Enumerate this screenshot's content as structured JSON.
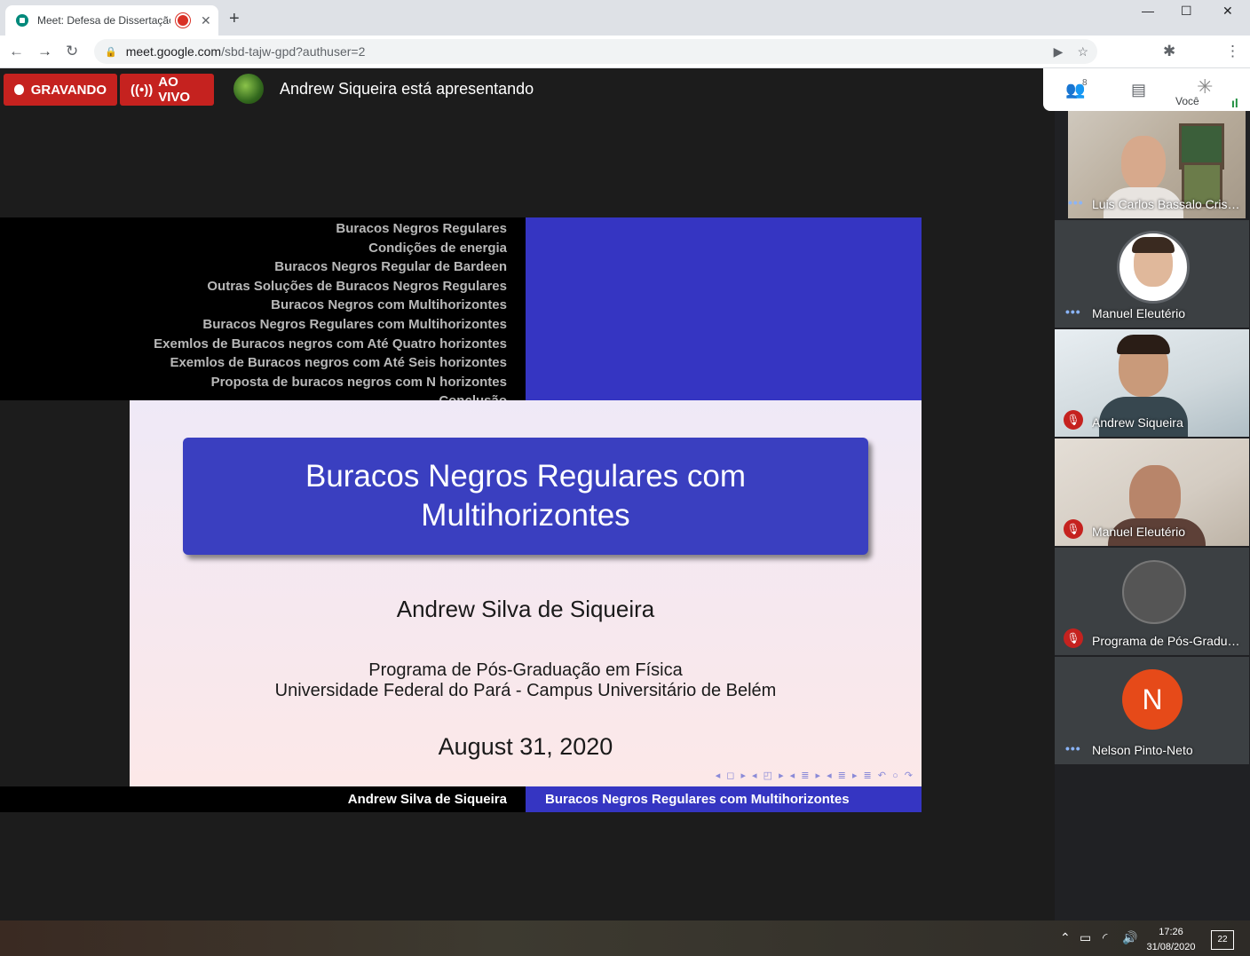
{
  "browser": {
    "tab_title": "Meet: Defesa de Dissertação",
    "tab_close": "✕",
    "new_tab": "+",
    "window_min": "—",
    "window_max": "☐",
    "window_close": "✕",
    "url_host": "meet.google.com",
    "url_path": "/sbd-tajw-gpd?authuser=2"
  },
  "meet": {
    "recording_label": "GRAVANDO",
    "live_label": "AO VIVO",
    "presenter_text": "Andrew Siqueira está apresentando",
    "participant_count": "8",
    "you_label": "Você"
  },
  "slide": {
    "toc": [
      "Buracos Negros Regulares",
      "Condições de energia",
      "Buracos Negros Regular de Bardeen",
      "Outras Soluções de Buracos Negros Regulares",
      "Buracos Negros com Multihorizontes",
      "Buracos Negros Regulares com Multihorizontes",
      "Exemlos de Buracos negros com Até Quatro horizontes",
      "Exemlos de Buracos negros com Até Seis horizontes",
      "Proposta de buracos negros com N horizontes",
      "Conclusão"
    ],
    "title_line1": "Buracos Negros Regulares com",
    "title_line2": "Multihorizontes",
    "author": "Andrew Silva de Siqueira",
    "program": "Programa de Pós-Graduação em Física",
    "university": "Universidade Federal do Pará - Campus Universitário de Belém",
    "date": "August 31, 2020",
    "nav_symbols": "◂ ◻ ▸ ◂ ◰ ▸ ◂ ≣ ▸ ◂ ≣ ▸  ≣  ↶ ○ ↷",
    "footer_left": "Andrew Silva de Siqueira",
    "footer_right": "Buracos Negros Regulares com Multihorizontes"
  },
  "participants": [
    {
      "name": "Luis Carlos Bassalo Crispino",
      "status": "dots"
    },
    {
      "name": "Manuel Eleutério",
      "status": "dots"
    },
    {
      "name": "Andrew Siqueira",
      "status": "muted"
    },
    {
      "name": "Manuel Eleutério",
      "status": "muted"
    },
    {
      "name": "Programa de Pós-Graduação em Física",
      "status": "muted"
    },
    {
      "name": "Nelson Pinto-Neto",
      "status": "dots",
      "initial": "N"
    }
  ],
  "taskbar": {
    "time": "17:26",
    "date": "31/08/2020",
    "notifications": "22"
  },
  "colors": {
    "recording_red": "#c5221f",
    "beamer_blue": "#3535c2",
    "meet_bg": "#202124",
    "avatar_orange": "#e64a19"
  }
}
